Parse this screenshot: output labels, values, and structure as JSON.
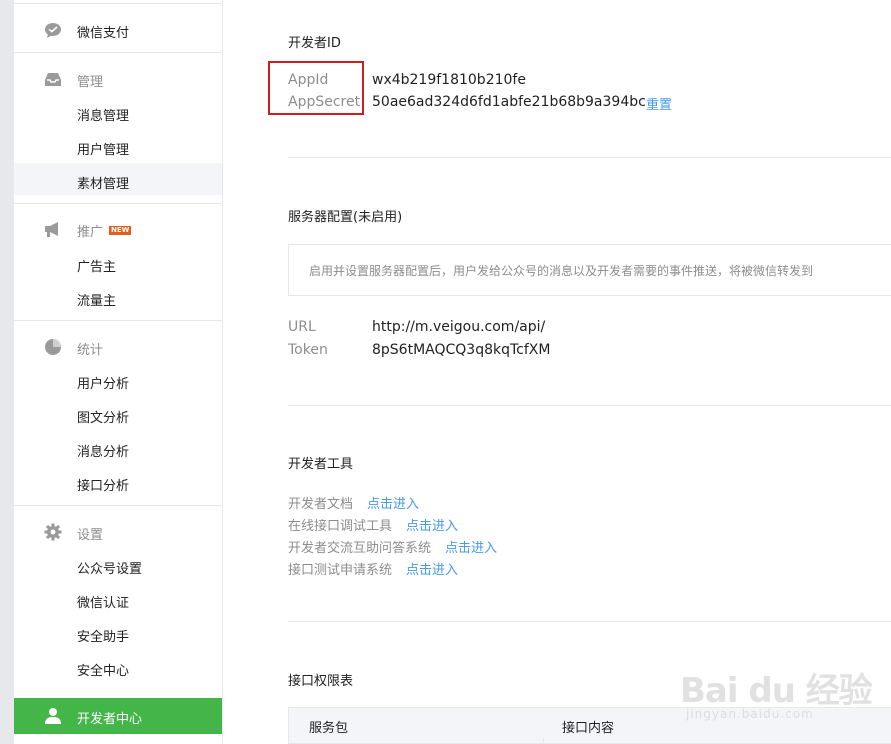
{
  "sidebar": {
    "wechat_pay": "微信支付",
    "manage": {
      "title": "管理",
      "items": [
        "消息管理",
        "用户管理",
        "素材管理"
      ]
    },
    "promote": {
      "title": "推广",
      "badge": "NEW",
      "items": [
        "广告主",
        "流量主"
      ]
    },
    "stats": {
      "title": "统计",
      "items": [
        "用户分析",
        "图文分析",
        "消息分析",
        "接口分析"
      ]
    },
    "settings": {
      "title": "设置",
      "items": [
        "公众号设置",
        "微信认证",
        "安全助手",
        "安全中心"
      ]
    },
    "developer_center": "开发者中心",
    "active_item": "素材管理"
  },
  "developer_id": {
    "title": "开发者ID",
    "appid_label": "AppId",
    "appid_value": "wx4b219f1810b210fe",
    "appsecret_label": "AppSecret",
    "appsecret_value": "50ae6ad324d6fd1abfe21b68b9a394bc",
    "reset_link": "重置"
  },
  "server_config": {
    "title": "服务器配置(未启用)",
    "notice": "启用并设置服务器配置后，用户发给公众号的消息以及开发者需要的事件推送，将被微信转发到",
    "url_label": "URL",
    "url_value": "http://m.veigou.com/api/",
    "token_label": "Token",
    "token_value": "8pS6tMAQCQ3q8kqTcfXM"
  },
  "dev_tools": {
    "title": "开发者工具",
    "rows": [
      {
        "label": "开发者文档",
        "link": "点击进入"
      },
      {
        "label": "在线接口调试工具",
        "link": "点击进入"
      },
      {
        "label": "开发者交流互助问答系统",
        "link": "点击进入"
      },
      {
        "label": "接口测试申请系统",
        "link": "点击进入"
      }
    ]
  },
  "permissions": {
    "title": "接口权限表",
    "headers": [
      "服务包",
      "接口内容"
    ]
  },
  "watermark": {
    "logo": "Bai du 经验",
    "sub": "jingyan.baidu.com"
  },
  "colors": {
    "accent_green": "#44b549",
    "link_blue": "#459ae9",
    "highlight_red": "#cc1f1f",
    "muted_text": "#8d8d8d"
  },
  "icons": {
    "wechat_pay": "chat-bubble-icon",
    "manage": "inbox-tray-icon",
    "promote": "megaphone-icon",
    "stats": "pie-chart-icon",
    "settings": "gear-icon",
    "developer_center": "user-icon"
  }
}
